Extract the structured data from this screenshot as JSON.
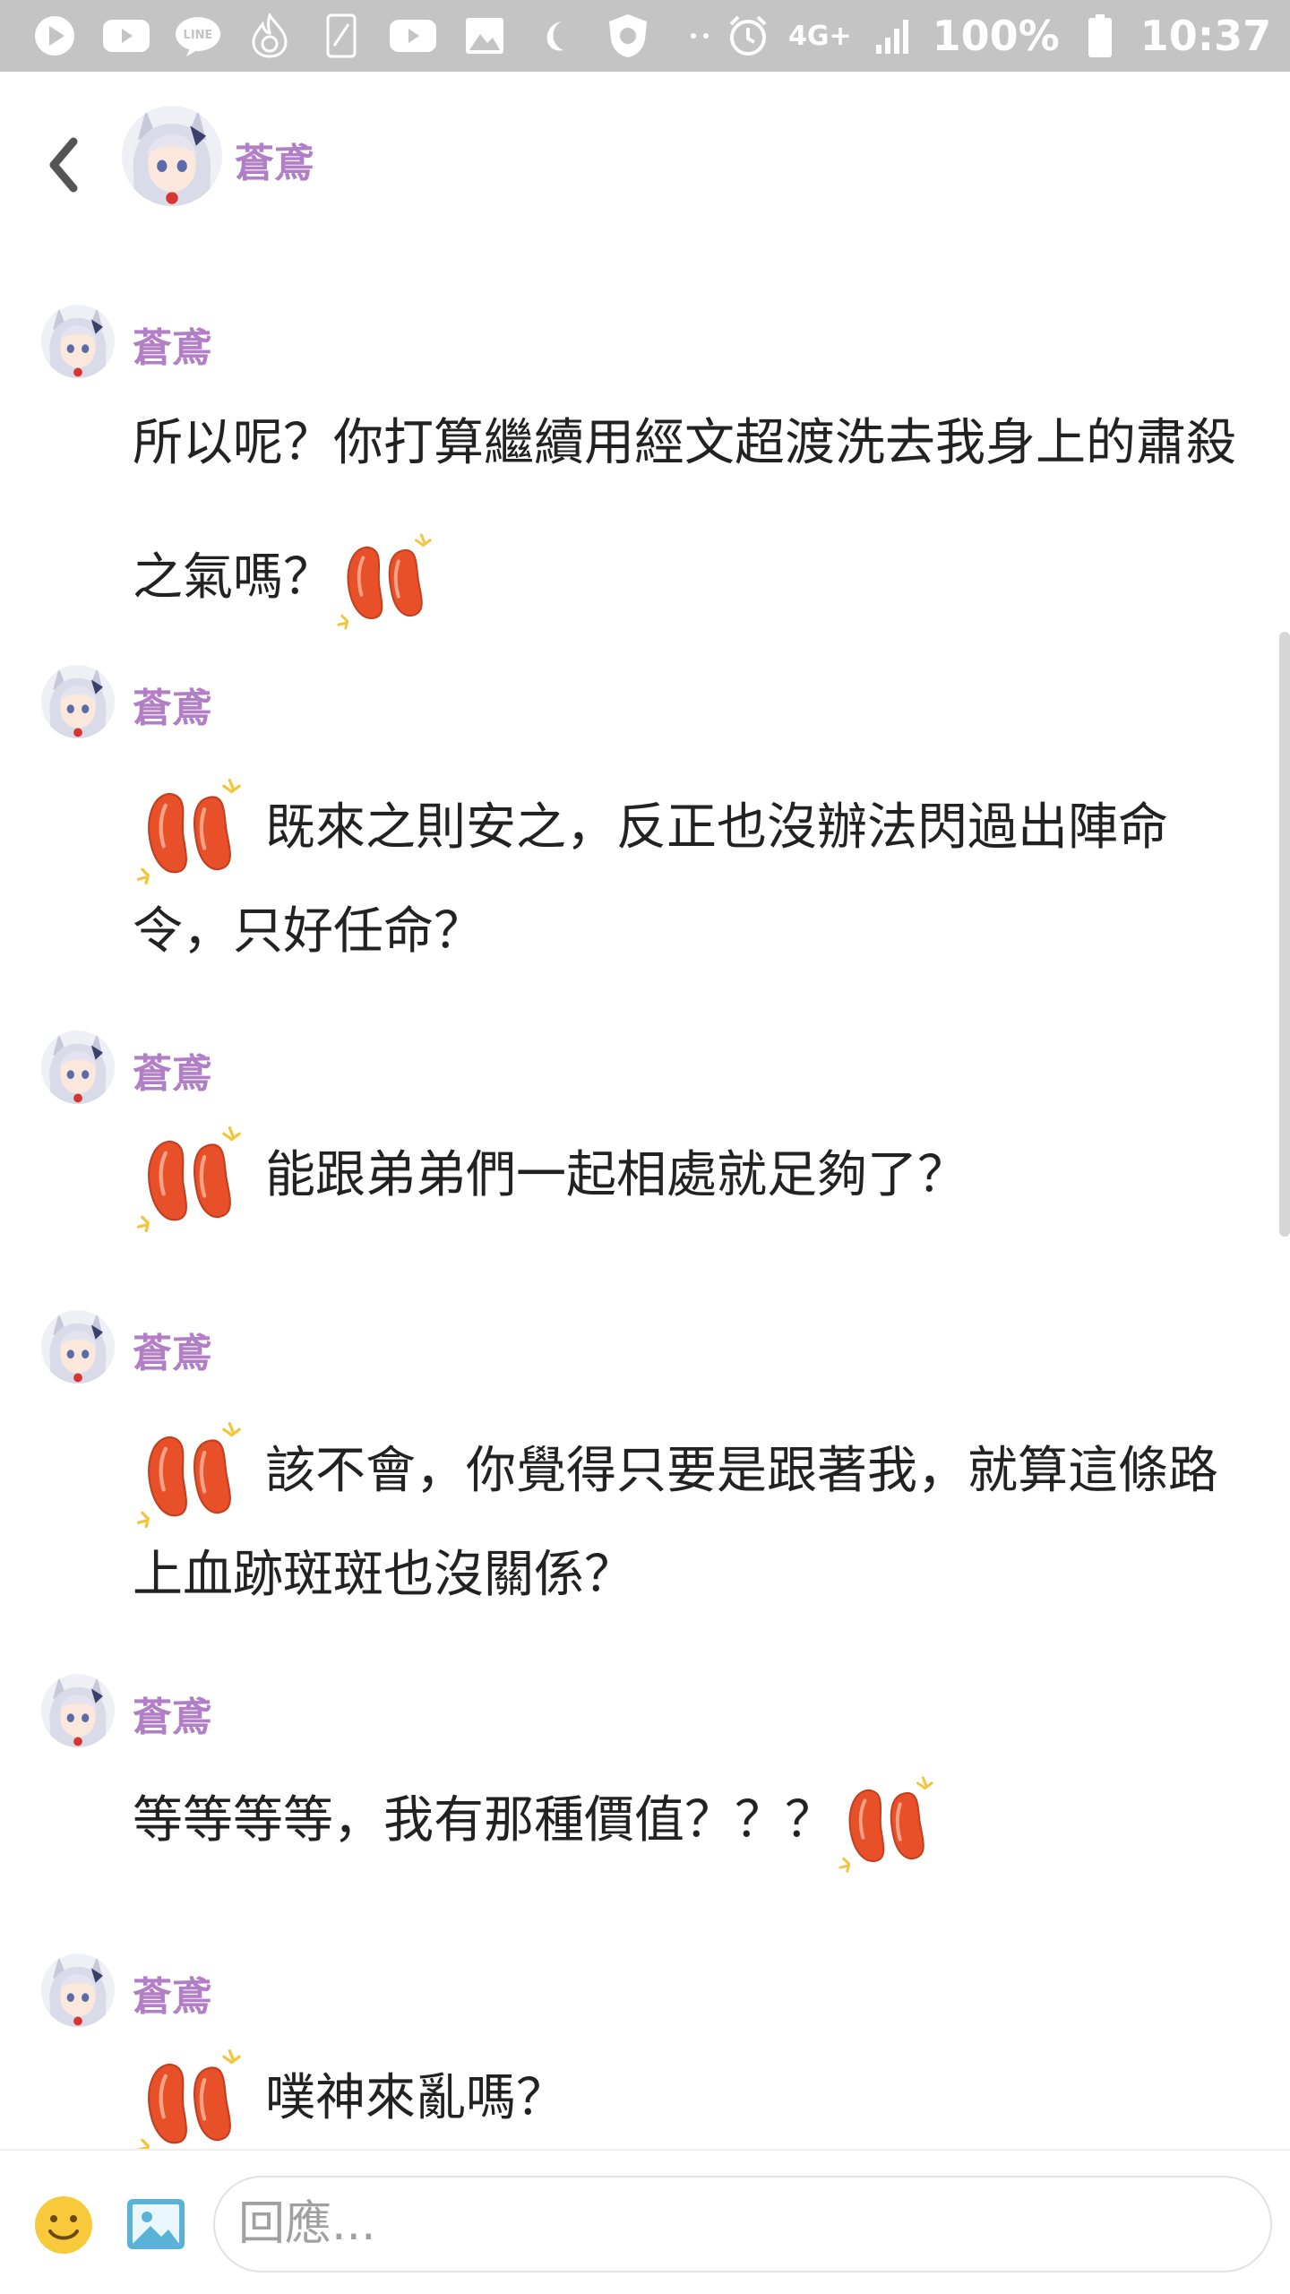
{
  "status_bar": {
    "battery_text": "100%",
    "time": "10:37",
    "network": "4G+"
  },
  "header": {
    "back_label": "<",
    "title": "蒼鳶"
  },
  "messages": [
    {
      "author": "蒼鳶",
      "text": "所以呢？你打算繼續用經文超渡洗去我身上的肅殺之氣嗎？",
      "sticker": "sausage-sticker"
    },
    {
      "author": "蒼鳶",
      "text": "既來之則安之，反正也沒辦法閃過出陣命令，只好任命？",
      "sticker": "sausage-sticker"
    },
    {
      "author": "蒼鳶",
      "text": "能跟弟弟們一起相處就足夠了？",
      "sticker": "sausage-sticker"
    },
    {
      "author": "蒼鳶",
      "text": "該不會，你覺得只要是跟著我，就算這條路上血跡斑斑也沒關係？",
      "sticker": "sausage-sticker"
    },
    {
      "author": "蒼鳶",
      "text": "等等等等，我有那種價值？？？",
      "sticker": "sausage-sticker"
    },
    {
      "author": "蒼鳶",
      "text": "噗神來亂嗎？",
      "sticker": "sausage-sticker"
    }
  ],
  "composer": {
    "placeholder": "回應..."
  },
  "colors": {
    "name": "#b27fc6",
    "status_bar": "#c4c4c4",
    "sticker": "#e8502a"
  }
}
